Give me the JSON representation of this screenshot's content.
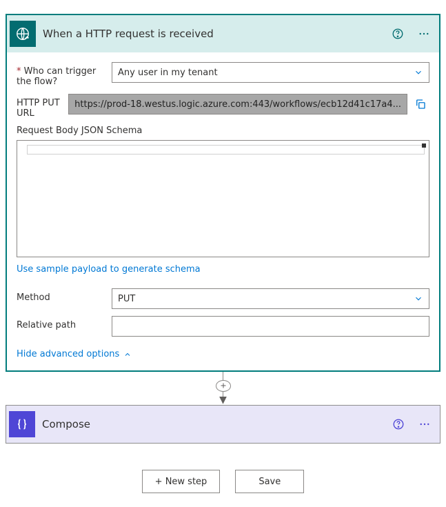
{
  "trigger": {
    "title": "When a HTTP request is received",
    "fields": {
      "who_label": "Who can trigger the flow?",
      "who_value": "Any user in my tenant",
      "url_label": "HTTP PUT URL",
      "url_value": "https://prod-18.westus.logic.azure.com:443/workflows/ecb12d41c17a4...",
      "schema_label": "Request Body JSON Schema",
      "schema_value": "",
      "sample_link": "Use sample payload to generate schema",
      "method_label": "Method",
      "method_value": "PUT",
      "relpath_label": "Relative path",
      "relpath_value": ""
    },
    "advanced_toggle": "Hide advanced options"
  },
  "compose": {
    "title": "Compose"
  },
  "footer": {
    "new_step": "+ New step",
    "save": "Save"
  },
  "icons": {
    "globe": "globe-icon",
    "json": "braces-icon",
    "help": "help-icon",
    "more": "more-icon",
    "chevron": "chevron-down-icon",
    "chevron_up": "chevron-up-icon",
    "copy": "copy-icon",
    "plus": "plus-icon"
  },
  "colors": {
    "trigger_accent": "#036c70",
    "compose_accent": "#4f46d6",
    "link": "#0078d4"
  }
}
